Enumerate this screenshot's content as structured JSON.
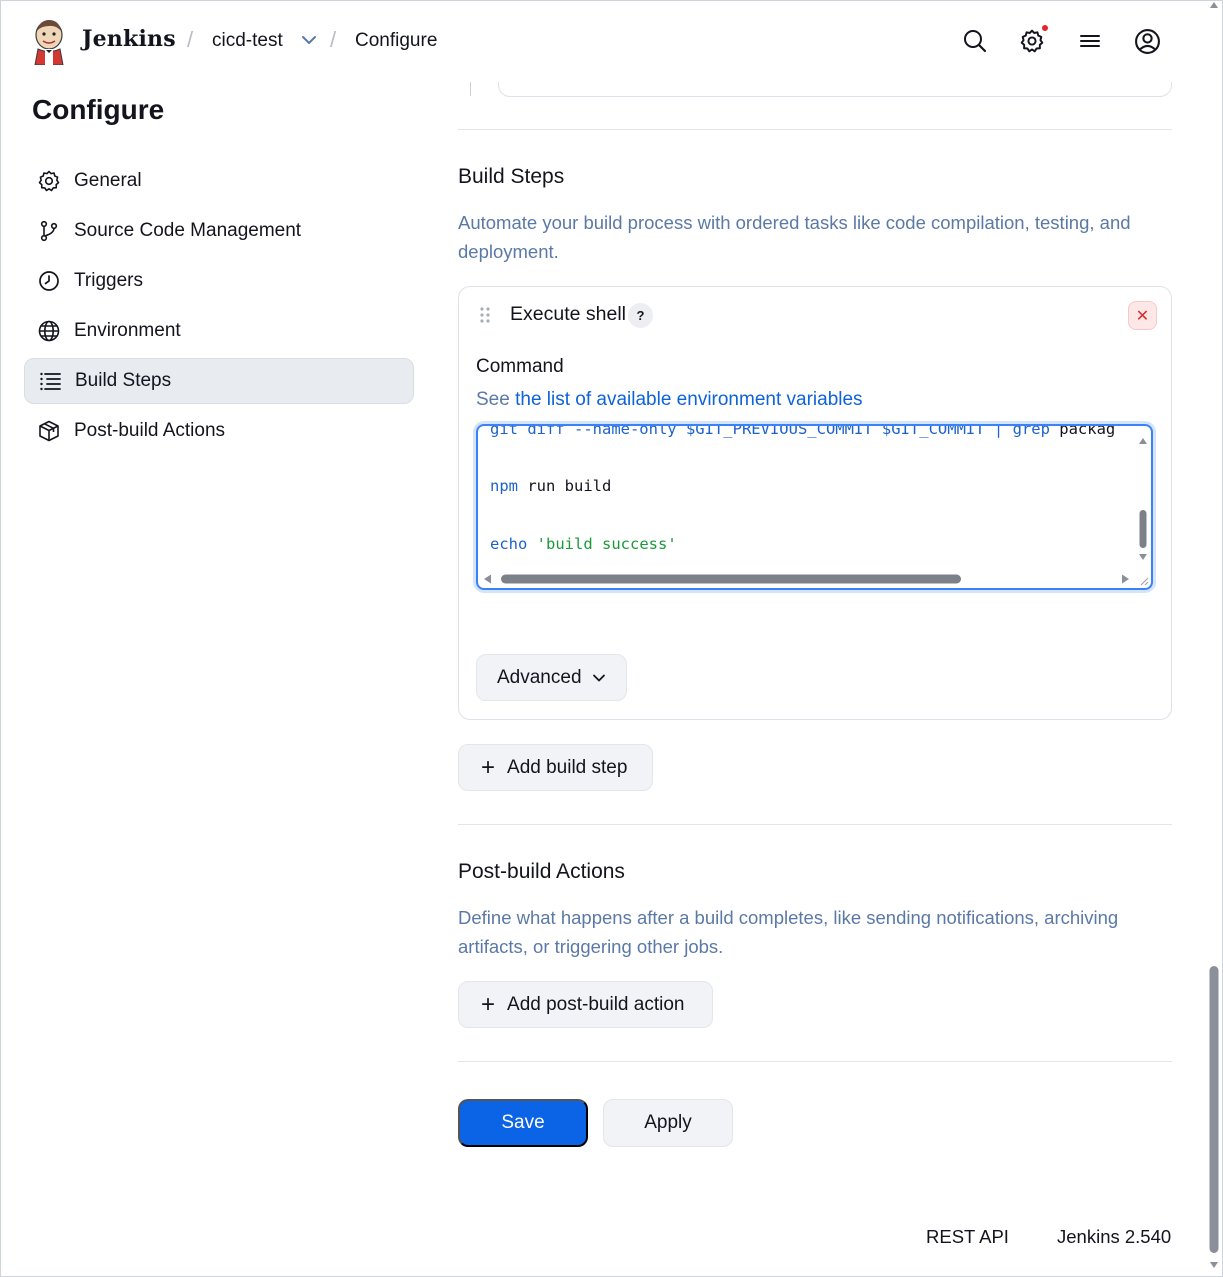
{
  "header": {
    "brand": "Jenkins",
    "breadcrumb": [
      {
        "label": "cicd-test"
      },
      {
        "label": "Configure"
      }
    ],
    "icons": [
      "search-icon",
      "settings-icon",
      "menu-icon",
      "user-icon"
    ],
    "notification_dot_color": "#e5242b"
  },
  "sidebar": {
    "title": "Configure",
    "items": [
      {
        "label": "General",
        "icon": "gear-icon"
      },
      {
        "label": "Source Code Management",
        "icon": "git-branch-icon"
      },
      {
        "label": "Triggers",
        "icon": "clock-icon"
      },
      {
        "label": "Environment",
        "icon": "globe-icon"
      },
      {
        "label": "Build Steps",
        "icon": "list-icon",
        "active": true
      },
      {
        "label": "Post-build Actions",
        "icon": "package-icon"
      }
    ]
  },
  "build_steps": {
    "title": "Build Steps",
    "description": "Automate your build process with ordered tasks like code compilation, testing, and deployment.",
    "step": {
      "title": "Execute shell",
      "help": "?",
      "close": "✕",
      "command_label": "Command",
      "see_prefix": "See",
      "see_link": "the list of available environment variables",
      "code_lines": [
        "git diff --name-only $GIT_PREVIOUS_COMMIT $GIT_COMMIT | grep packag",
        "npm run build",
        "echo 'build success'"
      ],
      "advanced_label": "Advanced"
    },
    "add_label": "Add build step"
  },
  "post_build": {
    "title": "Post-build Actions",
    "description": "Define what happens after a build completes, like sending notifications, archiving artifacts, or triggering other jobs.",
    "add_label": "Add post-build action"
  },
  "actions": {
    "save": "Save",
    "apply": "Apply"
  },
  "footer": {
    "rest_api": "REST API",
    "version": "Jenkins 2.540"
  },
  "colors": {
    "primary": "#0b63e5",
    "link": "#0e63d9",
    "description": "#5b79a6",
    "code_keyword": "#1d63c9",
    "code_string": "#1a9a3a"
  }
}
